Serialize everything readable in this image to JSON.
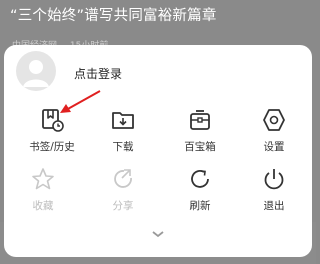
{
  "background": {
    "headline": "“三个始终”谱写共同富裕新篇章",
    "source": "中国经济网",
    "time": "15小时前"
  },
  "sheet": {
    "login_label": "点击登录",
    "items": [
      {
        "label": "书签/历史",
        "icon": "bookmark-history-icon",
        "enabled": true
      },
      {
        "label": "下载",
        "icon": "download-icon",
        "enabled": true
      },
      {
        "label": "百宝箱",
        "icon": "toolbox-icon",
        "enabled": true
      },
      {
        "label": "设置",
        "icon": "settings-icon",
        "enabled": true
      },
      {
        "label": "收藏",
        "icon": "star-icon",
        "enabled": false
      },
      {
        "label": "分享",
        "icon": "share-icon",
        "enabled": false
      },
      {
        "label": "刷新",
        "icon": "refresh-icon",
        "enabled": true
      },
      {
        "label": "退出",
        "icon": "power-icon",
        "enabled": true
      }
    ]
  },
  "annotation": {
    "color": "#e02020"
  }
}
